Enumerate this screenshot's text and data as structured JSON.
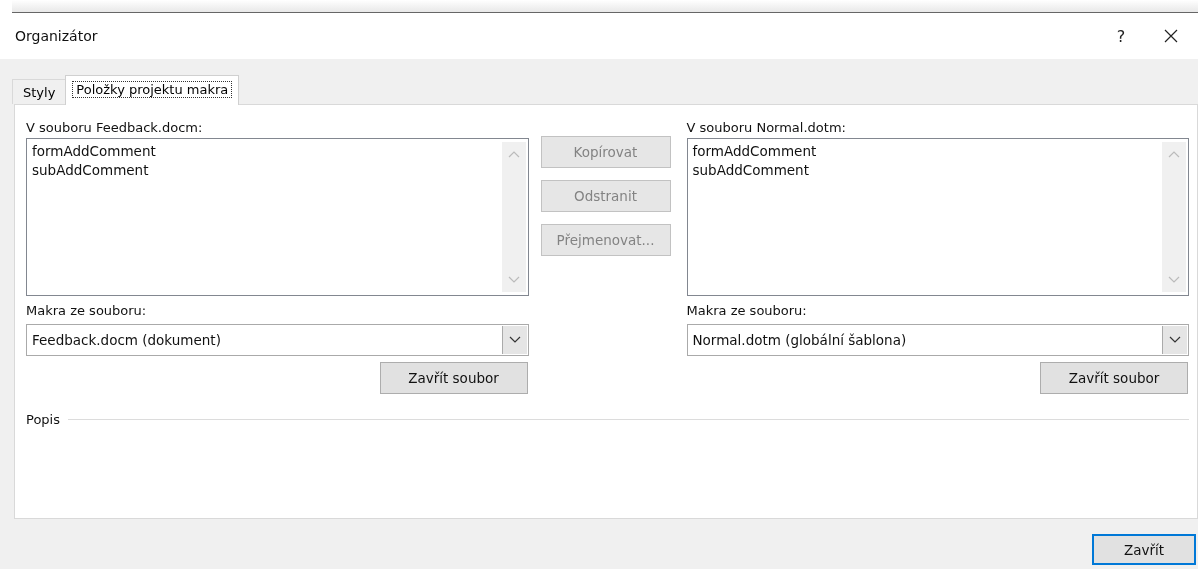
{
  "window": {
    "title": "Organizátor",
    "help": "?"
  },
  "tabs": [
    {
      "label": "Styly",
      "selected": false
    },
    {
      "label": "Položky projektu makra",
      "selected": true
    }
  ],
  "panes": [
    {
      "list_label": "V souboru Feedback.docm:",
      "items": [
        "formAddComment",
        "subAddComment"
      ],
      "source_label": "Makra ze souboru:",
      "source_value": "Feedback.docm (dokument)",
      "close_button": "Zavřít soubor"
    },
    {
      "list_label": "V souboru Normal.dotm:",
      "items": [
        "formAddComment",
        "subAddComment"
      ],
      "source_label": "Makra ze souboru:",
      "source_value": "Normal.dotm (globální šablona)",
      "close_button": "Zavřít soubor"
    }
  ],
  "actions": [
    {
      "label": "Kopírovat",
      "disabled": true
    },
    {
      "label": "Odstranit",
      "disabled": true
    },
    {
      "label": "Přejmenovat...",
      "disabled": true
    }
  ],
  "description": {
    "label": "Popis"
  },
  "footer": {
    "button": "Zavřít"
  }
}
